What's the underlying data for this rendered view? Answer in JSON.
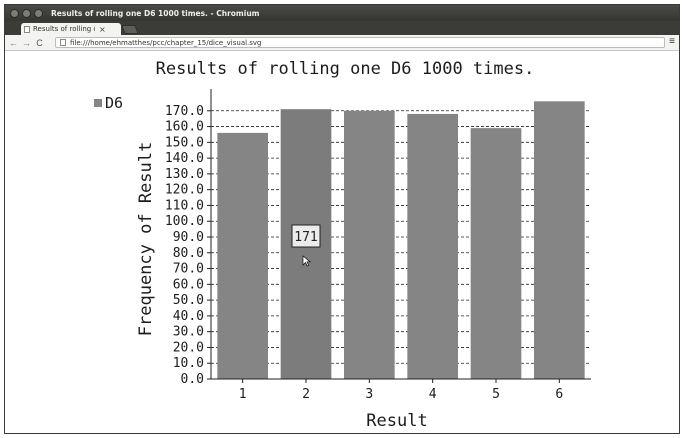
{
  "window": {
    "title": "Results of rolling one D6 1000 times. - Chromium"
  },
  "tab": {
    "title": "Results of rolling one",
    "close": "×"
  },
  "toolbar": {
    "back": "←",
    "forward": "→",
    "reload": "C",
    "url": "file:///home/ehmatthes/pcc/chapter_15/dice_visual.svg",
    "menu": "≡"
  },
  "colors": {
    "bar": "#858585",
    "bar_hover": "#7c7c7c",
    "axis_text": "#1c1c1c",
    "grid": "#222222"
  },
  "chart_data": {
    "type": "bar",
    "title": "Results of rolling one D6 1000 times.",
    "xlabel": "Result",
    "ylabel": "Frequency of Result",
    "categories": [
      "1",
      "2",
      "3",
      "4",
      "5",
      "6"
    ],
    "series": [
      {
        "name": "D6",
        "values": [
          156,
          171,
          170,
          168,
          159,
          176
        ]
      }
    ],
    "ylim": [
      0,
      180
    ],
    "yticks": [
      "0.0",
      "10.0",
      "20.0",
      "30.0",
      "40.0",
      "50.0",
      "60.0",
      "70.0",
      "80.0",
      "90.0",
      "100.0",
      "110.0",
      "120.0",
      "130.0",
      "140.0",
      "150.0",
      "160.0",
      "170.0"
    ],
    "grid": true,
    "legend_position": "top-left",
    "tooltip": {
      "category": "2",
      "text": "171"
    }
  }
}
